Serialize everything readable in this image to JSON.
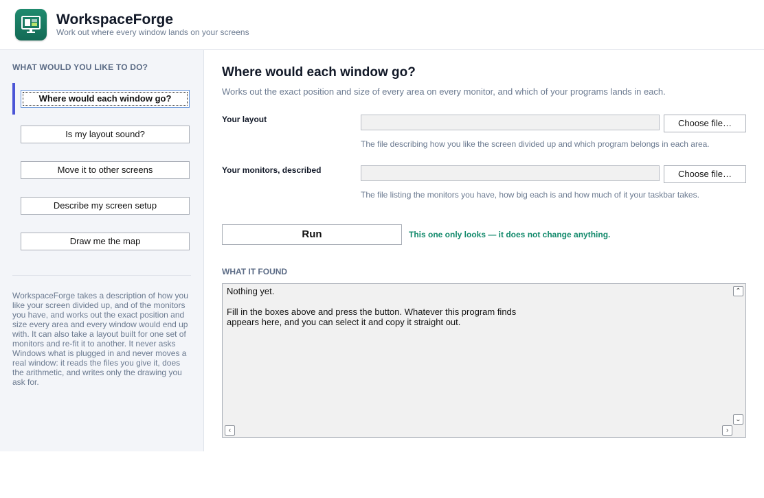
{
  "app": {
    "title": "WorkspaceForge",
    "subtitle": "Work out where every window lands on your screens",
    "icon": "monitor-icon",
    "brand_color": "#1a7d63"
  },
  "sidebar": {
    "heading": "WHAT WOULD YOU LIKE TO DO?",
    "accent_color": "#4b55d6",
    "items": [
      {
        "label": "Where would each window go?",
        "active": true
      },
      {
        "label": "Is my layout sound?",
        "active": false
      },
      {
        "label": "Move it to other screens",
        "active": false
      },
      {
        "label": "Describe my screen setup",
        "active": false
      },
      {
        "label": "Draw me the map",
        "active": false
      }
    ],
    "about": "WorkspaceForge takes a description of how you like your screen divided up, and of the monitors you have, and works out the exact position and size every area and every window would end up with. It can also take a layout built for one set of monitors and re-fit it to another. It never asks Windows what is plugged in and never moves a real window: it reads the files you give it, does the arithmetic, and writes only the drawing you ask for."
  },
  "main": {
    "title": "Where would each window go?",
    "description": "Works out the exact position and size of every area on every monitor, and which of your programs lands in each.",
    "fields": [
      {
        "label": "Your layout",
        "value": "",
        "button": "Choose file…",
        "hint": "The file describing how you like the screen divided up and which program belongs in each area."
      },
      {
        "label": "Your monitors, described",
        "value": "",
        "button": "Choose file…",
        "hint": "The file listing the monitors you have, how big each is and how much of it your taskbar takes."
      }
    ],
    "run_label": "Run",
    "run_note": "This one only looks — it does not change anything.",
    "run_note_color": "#138a6c",
    "output_heading": "WHAT IT FOUND",
    "output_text": "Nothing yet.\n\nFill in the boxes above and press the button. Whatever this program finds\nappears here, and you can select it and copy it straight out."
  }
}
